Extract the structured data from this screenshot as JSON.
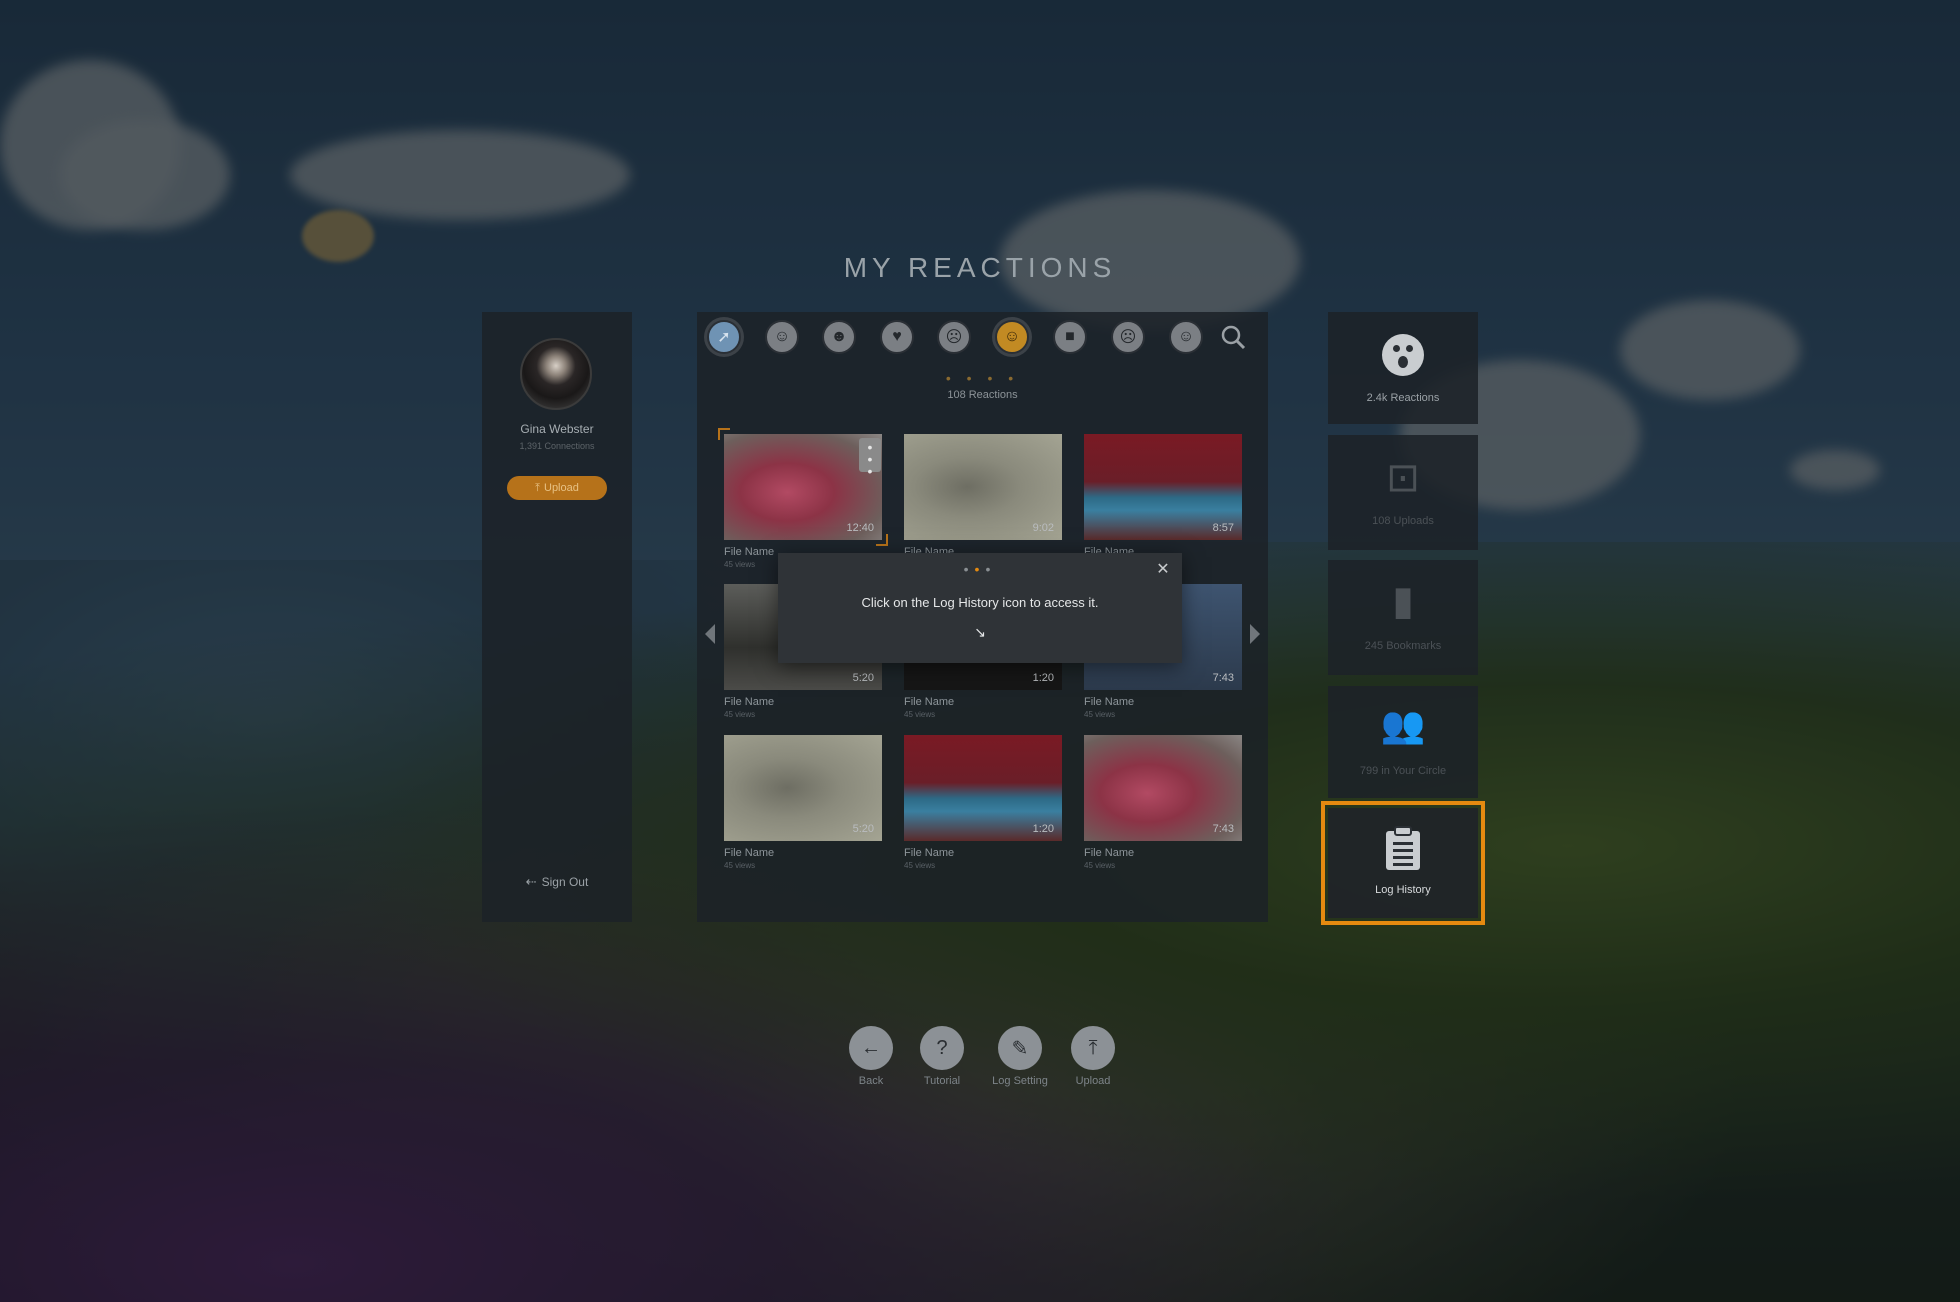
{
  "title": "MY REACTIONS",
  "profile": {
    "name": "Gina Webster",
    "connections": "1,391 Connections",
    "upload_label": "Upload",
    "signout_label": "Sign Out"
  },
  "reactions": {
    "count_label": "108 Reactions",
    "page_dots": "• • • •",
    "emoji_icons": [
      "rocket-icon",
      "laugh-emoji-icon",
      "surprised-emoji-icon",
      "heart-emoji-icon",
      "frown-emoji-icon",
      "smile-emoji-icon",
      "sunglasses-emoji-icon",
      "sad-emoji-icon",
      "wink-emoji-icon"
    ],
    "emoji_glyphs": [
      "➚",
      "☺",
      "☻",
      "♥",
      "☹",
      "☺",
      "■",
      "☹",
      "☺"
    ],
    "search_icon": "search-icon",
    "items": [
      {
        "name": "File Name",
        "views": "45 views",
        "duration": "12:40",
        "style": "t-red"
      },
      {
        "name": "File Name",
        "views": "45 views",
        "duration": "9:02",
        "style": "t-sketch"
      },
      {
        "name": "File Name",
        "views": "45 views",
        "duration": "8:57",
        "style": "t-blue"
      },
      {
        "name": "File Name",
        "views": "45 views",
        "duration": "5:20",
        "style": "t-street"
      },
      {
        "name": "File Name",
        "views": "45 views",
        "duration": "1:20",
        "style": "t-dark"
      },
      {
        "name": "File Name",
        "views": "45 views",
        "duration": "7:43",
        "style": "t-bluegray"
      },
      {
        "name": "File Name",
        "views": "45 views",
        "duration": "5:20",
        "style": "t-sketch"
      },
      {
        "name": "File Name",
        "views": "45 views",
        "duration": "1:20",
        "style": "t-blue"
      },
      {
        "name": "File Name",
        "views": "45 views",
        "duration": "7:43",
        "style": "t-red"
      }
    ]
  },
  "side_cards": [
    {
      "label": "2.4k Reactions",
      "icon": "face-icon"
    },
    {
      "label": "108 Uploads",
      "icon": "upload-box-icon"
    },
    {
      "label": "245 Bookmarks",
      "icon": "bookmark-icon"
    },
    {
      "label": "799 in Your Circle",
      "icon": "people-icon"
    },
    {
      "label": "Log History",
      "icon": "clipboard-icon"
    }
  ],
  "tooltip": {
    "message": "Click on the Log History icon to access it.",
    "pointer": "↘",
    "close": "✕"
  },
  "toolbar": {
    "back": "Back",
    "tutorial": "Tutorial",
    "log_setting": "Log Setting",
    "upload": "Upload"
  },
  "colors": {
    "accent": "#e58a10",
    "upload_button": "#b6721a"
  }
}
